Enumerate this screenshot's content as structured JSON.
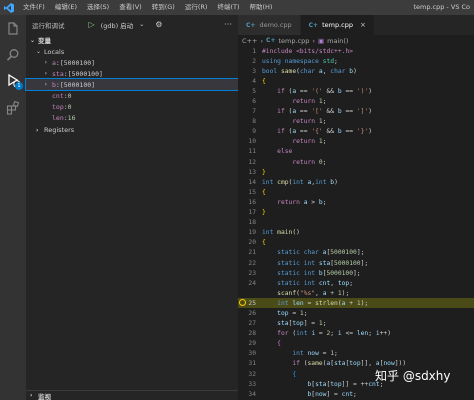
{
  "titlebar": {
    "logo_icon": "vscode-icon",
    "menu": [
      "文件(F)",
      "编辑(E)",
      "选择(S)",
      "查看(V)",
      "转到(G)",
      "运行(R)",
      "终端(T)",
      "帮助(H)"
    ],
    "window_title": "temp.cpp - VS Co"
  },
  "activitybar": {
    "icons": [
      "files-icon",
      "search-icon",
      "run-debug-icon",
      "extensions-icon"
    ],
    "badge": "1"
  },
  "sidebar": {
    "header_label": "运行和调试",
    "config_name": "(gdb) 启动",
    "variables_section": "变量",
    "locals_section": "Locals",
    "locals": [
      {
        "name": "a",
        "value": "[5000100]",
        "expandable": true,
        "selected": false
      },
      {
        "name": "sta",
        "value": "[5000100]",
        "expandable": true,
        "selected": false
      },
      {
        "name": "b",
        "value": "[5000100]",
        "expandable": true,
        "selected": true
      },
      {
        "name": "cnt",
        "value": "0",
        "expandable": false,
        "selected": false
      },
      {
        "name": "top",
        "value": "0",
        "expandable": false,
        "selected": false
      },
      {
        "name": "len",
        "value": "16",
        "expandable": false,
        "selected": false
      }
    ],
    "registers_section": "Registers",
    "watch_section": "监视"
  },
  "editor": {
    "tabs": [
      {
        "label": "demo.cpp",
        "active": false
      },
      {
        "label": "temp.cpp",
        "active": true
      }
    ],
    "breadcrumb": [
      "C++",
      "temp.cpp",
      "main()"
    ],
    "current_line": 25,
    "lines": [
      {
        "n": "1",
        "tokens": [
          [
            "#include <bits/stdc++.h>",
            "#c586c0"
          ]
        ]
      },
      {
        "n": "2",
        "tokens": [
          [
            "using namespace ",
            "#569cd6"
          ],
          [
            "std",
            "#4ec9b0"
          ],
          [
            ";",
            "#d4d4d4"
          ]
        ]
      },
      {
        "n": "3",
        "tokens": [
          [
            "bool ",
            "#569cd6"
          ],
          [
            "same",
            "#dcdcaa"
          ],
          [
            "(",
            "#d4d4d4"
          ],
          [
            "char ",
            "#569cd6"
          ],
          [
            "a",
            "#9cdcfe"
          ],
          [
            ", ",
            "#d4d4d4"
          ],
          [
            "char ",
            "#569cd6"
          ],
          [
            "b",
            "#9cdcfe"
          ],
          [
            ")",
            "#d4d4d4"
          ]
        ]
      },
      {
        "n": "4",
        "tokens": [
          [
            "{",
            "#ffd700"
          ]
        ]
      },
      {
        "n": "5",
        "tokens": [
          [
            "    if ",
            "#c586c0"
          ],
          [
            "(",
            "#d4d4d4"
          ],
          [
            "a",
            "#9cdcfe"
          ],
          [
            " == ",
            "#d4d4d4"
          ],
          [
            "'('",
            "#ce9178"
          ],
          [
            " && ",
            "#d4d4d4"
          ],
          [
            "b",
            "#9cdcfe"
          ],
          [
            " == ",
            "#d4d4d4"
          ],
          [
            "')'",
            "#ce9178"
          ],
          [
            ")",
            "#d4d4d4"
          ]
        ]
      },
      {
        "n": "6",
        "tokens": [
          [
            "        return ",
            "#c586c0"
          ],
          [
            "1",
            "#b5cea8"
          ],
          [
            ";",
            "#d4d4d4"
          ]
        ]
      },
      {
        "n": "7",
        "tokens": [
          [
            "    if ",
            "#c586c0"
          ],
          [
            "(",
            "#d4d4d4"
          ],
          [
            "a",
            "#9cdcfe"
          ],
          [
            " == ",
            "#d4d4d4"
          ],
          [
            "'['",
            "#ce9178"
          ],
          [
            " && ",
            "#d4d4d4"
          ],
          [
            "b",
            "#9cdcfe"
          ],
          [
            " == ",
            "#d4d4d4"
          ],
          [
            "']'",
            "#ce9178"
          ],
          [
            ")",
            "#d4d4d4"
          ]
        ]
      },
      {
        "n": "8",
        "tokens": [
          [
            "        return ",
            "#c586c0"
          ],
          [
            "1",
            "#b5cea8"
          ],
          [
            ";",
            "#d4d4d4"
          ]
        ]
      },
      {
        "n": "9",
        "tokens": [
          [
            "    if ",
            "#c586c0"
          ],
          [
            "(",
            "#d4d4d4"
          ],
          [
            "a",
            "#9cdcfe"
          ],
          [
            " == ",
            "#d4d4d4"
          ],
          [
            "'{'",
            "#ce9178"
          ],
          [
            " && ",
            "#d4d4d4"
          ],
          [
            "b",
            "#9cdcfe"
          ],
          [
            " == ",
            "#d4d4d4"
          ],
          [
            "'}'",
            "#ce9178"
          ],
          [
            ")",
            "#d4d4d4"
          ]
        ]
      },
      {
        "n": "10",
        "tokens": [
          [
            "        return ",
            "#c586c0"
          ],
          [
            "1",
            "#b5cea8"
          ],
          [
            ";",
            "#d4d4d4"
          ]
        ]
      },
      {
        "n": "11",
        "tokens": [
          [
            "    else",
            "#c586c0"
          ]
        ]
      },
      {
        "n": "12",
        "tokens": [
          [
            "        return ",
            "#c586c0"
          ],
          [
            "0",
            "#b5cea8"
          ],
          [
            ";",
            "#d4d4d4"
          ]
        ]
      },
      {
        "n": "13",
        "tokens": [
          [
            "}",
            "#ffd700"
          ]
        ]
      },
      {
        "n": "14",
        "tokens": [
          [
            "int ",
            "#569cd6"
          ],
          [
            "cmp",
            "#dcdcaa"
          ],
          [
            "(",
            "#d4d4d4"
          ],
          [
            "int ",
            "#569cd6"
          ],
          [
            "a",
            "#9cdcfe"
          ],
          [
            ",",
            "#d4d4d4"
          ],
          [
            "int ",
            "#569cd6"
          ],
          [
            "b",
            "#9cdcfe"
          ],
          [
            ")",
            "#d4d4d4"
          ]
        ]
      },
      {
        "n": "15",
        "tokens": [
          [
            "{",
            "#ffd700"
          ]
        ]
      },
      {
        "n": "16",
        "tokens": [
          [
            "    return ",
            "#c586c0"
          ],
          [
            "a",
            "#9cdcfe"
          ],
          [
            " > ",
            "#d4d4d4"
          ],
          [
            "b",
            "#9cdcfe"
          ],
          [
            ";",
            "#d4d4d4"
          ]
        ]
      },
      {
        "n": "17",
        "tokens": [
          [
            "}",
            "#ffd700"
          ]
        ]
      },
      {
        "n": "18",
        "tokens": []
      },
      {
        "n": "19",
        "tokens": [
          [
            "int ",
            "#569cd6"
          ],
          [
            "main",
            "#dcdcaa"
          ],
          [
            "()",
            "#d4d4d4"
          ]
        ]
      },
      {
        "n": "20",
        "tokens": [
          [
            "{",
            "#ffd700"
          ]
        ]
      },
      {
        "n": "21",
        "tokens": [
          [
            "    static ",
            "#569cd6"
          ],
          [
            "char ",
            "#569cd6"
          ],
          [
            "a",
            "#9cdcfe"
          ],
          [
            "[",
            "#d4d4d4"
          ],
          [
            "5000100",
            "#b5cea8"
          ],
          [
            "];",
            "#d4d4d4"
          ]
        ]
      },
      {
        "n": "22",
        "tokens": [
          [
            "    static ",
            "#569cd6"
          ],
          [
            "int ",
            "#569cd6"
          ],
          [
            "sta",
            "#9cdcfe"
          ],
          [
            "[",
            "#d4d4d4"
          ],
          [
            "5000100",
            "#b5cea8"
          ],
          [
            "];",
            "#d4d4d4"
          ]
        ]
      },
      {
        "n": "23",
        "tokens": [
          [
            "    static ",
            "#569cd6"
          ],
          [
            "int ",
            "#569cd6"
          ],
          [
            "b",
            "#9cdcfe"
          ],
          [
            "[",
            "#d4d4d4"
          ],
          [
            "5000100",
            "#b5cea8"
          ],
          [
            "];",
            "#d4d4d4"
          ]
        ]
      },
      {
        "n": "24",
        "tokens": [
          [
            "    static ",
            "#569cd6"
          ],
          [
            "int ",
            "#569cd6"
          ],
          [
            "cnt",
            "#9cdcfe"
          ],
          [
            ", ",
            "#d4d4d4"
          ],
          [
            "top",
            "#9cdcfe"
          ],
          [
            ";",
            "#d4d4d4"
          ]
        ]
      },
      {
        "n": "",
        "tokens": [
          [
            "    scanf",
            "#dcdcaa"
          ],
          [
            "(",
            "#d4d4d4"
          ],
          [
            "\"%s\"",
            "#ce9178"
          ],
          [
            ", ",
            "#d4d4d4"
          ],
          [
            "a",
            "#9cdcfe"
          ],
          [
            " + ",
            "#d4d4d4"
          ],
          [
            "1",
            "#b5cea8"
          ],
          [
            ");",
            "#d4d4d4"
          ]
        ]
      },
      {
        "n": "25",
        "tokens": [
          [
            "    int ",
            "#569cd6"
          ],
          [
            "len",
            "#9cdcfe"
          ],
          [
            " = ",
            "#d4d4d4"
          ],
          [
            "strlen",
            "#dcdcaa"
          ],
          [
            "(",
            "#d4d4d4"
          ],
          [
            "a",
            "#9cdcfe"
          ],
          [
            " + ",
            "#d4d4d4"
          ],
          [
            "1",
            "#b5cea8"
          ],
          [
            ");",
            "#d4d4d4"
          ]
        ]
      },
      {
        "n": "26",
        "tokens": [
          [
            "    top",
            "#9cdcfe"
          ],
          [
            " = ",
            "#d4d4d4"
          ],
          [
            "1",
            "#b5cea8"
          ],
          [
            ";",
            "#d4d4d4"
          ]
        ]
      },
      {
        "n": "27",
        "tokens": [
          [
            "    sta",
            "#9cdcfe"
          ],
          [
            "[",
            "#d4d4d4"
          ],
          [
            "top",
            "#9cdcfe"
          ],
          [
            "] = ",
            "#d4d4d4"
          ],
          [
            "1",
            "#b5cea8"
          ],
          [
            ";",
            "#d4d4d4"
          ]
        ]
      },
      {
        "n": "28",
        "tokens": [
          [
            "    for ",
            "#c586c0"
          ],
          [
            "(",
            "#d4d4d4"
          ],
          [
            "int ",
            "#569cd6"
          ],
          [
            "i",
            "#9cdcfe"
          ],
          [
            " = ",
            "#d4d4d4"
          ],
          [
            "2",
            "#b5cea8"
          ],
          [
            "; ",
            "#d4d4d4"
          ],
          [
            "i",
            "#9cdcfe"
          ],
          [
            " <= ",
            "#d4d4d4"
          ],
          [
            "len",
            "#9cdcfe"
          ],
          [
            "; ",
            "#d4d4d4"
          ],
          [
            "i",
            "#9cdcfe"
          ],
          [
            "++)",
            "#d4d4d4"
          ]
        ]
      },
      {
        "n": "29",
        "tokens": [
          [
            "    {",
            "#da70d6"
          ]
        ]
      },
      {
        "n": "30",
        "tokens": [
          [
            "        int ",
            "#569cd6"
          ],
          [
            "now",
            "#9cdcfe"
          ],
          [
            " = ",
            "#d4d4d4"
          ],
          [
            "1",
            "#b5cea8"
          ],
          [
            ";",
            "#d4d4d4"
          ]
        ]
      },
      {
        "n": "31",
        "tokens": [
          [
            "        if ",
            "#c586c0"
          ],
          [
            "(",
            "#d4d4d4"
          ],
          [
            "same",
            "#dcdcaa"
          ],
          [
            "(",
            "#d4d4d4"
          ],
          [
            "a",
            "#9cdcfe"
          ],
          [
            "[",
            "#d4d4d4"
          ],
          [
            "sta",
            "#9cdcfe"
          ],
          [
            "[",
            "#d4d4d4"
          ],
          [
            "top",
            "#9cdcfe"
          ],
          [
            "]], ",
            "#d4d4d4"
          ],
          [
            "a",
            "#9cdcfe"
          ],
          [
            "[",
            "#d4d4d4"
          ],
          [
            "now",
            "#9cdcfe"
          ],
          [
            "]))",
            "#d4d4d4"
          ]
        ]
      },
      {
        "n": "32",
        "tokens": [
          [
            "        {",
            "#179fff"
          ]
        ]
      },
      {
        "n": "33",
        "tokens": [
          [
            "            b",
            "#9cdcfe"
          ],
          [
            "[",
            "#d4d4d4"
          ],
          [
            "sta",
            "#9cdcfe"
          ],
          [
            "[",
            "#d4d4d4"
          ],
          [
            "top",
            "#9cdcfe"
          ],
          [
            "]] = ++",
            "#d4d4d4"
          ],
          [
            "cnt",
            "#9cdcfe"
          ],
          [
            ";",
            "#d4d4d4"
          ]
        ]
      },
      {
        "n": "34",
        "tokens": [
          [
            "            b",
            "#9cdcfe"
          ],
          [
            "[",
            "#d4d4d4"
          ],
          [
            "now",
            "#9cdcfe"
          ],
          [
            "] = ",
            "#d4d4d4"
          ],
          [
            "cnt",
            "#9cdcfe"
          ],
          [
            ";",
            "#d4d4d4"
          ]
        ]
      },
      {
        "n": "35",
        "tokens": [
          [
            "            sta",
            "#9cdcfe"
          ],
          [
            "[",
            "#d4d4d4"
          ],
          [
            "top",
            "#9cdcfe"
          ],
          [
            "--] = ",
            "#d4d4d4"
          ],
          [
            "0",
            "#b5cea8"
          ],
          [
            ";",
            "#d4d4d4"
          ]
        ]
      }
    ]
  },
  "watermark": "知乎 @sdxhy"
}
